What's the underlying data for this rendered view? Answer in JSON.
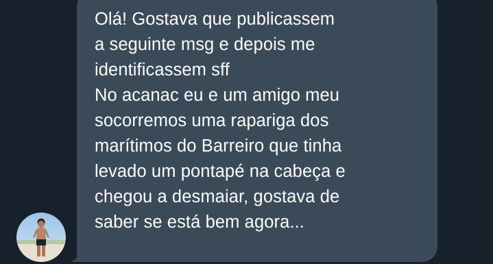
{
  "message": {
    "text": "Olá! Gostava que publicassem\na seguinte msg e depois me\nidentificassem sff\nNo acanac eu e um amigo meu\nsocorremos uma rapariga dos\nmarítimos do Barreiro que tinha\nlevado um pontapé na cabeça e\nchegou a desmaiar, gostava de\nsaber se está bem agora..."
  },
  "sender": {
    "avatar_icon": "user-avatar-photo"
  },
  "colors": {
    "background": "#17212b",
    "bubble": "#3b4a59",
    "text": "#ffffff"
  }
}
